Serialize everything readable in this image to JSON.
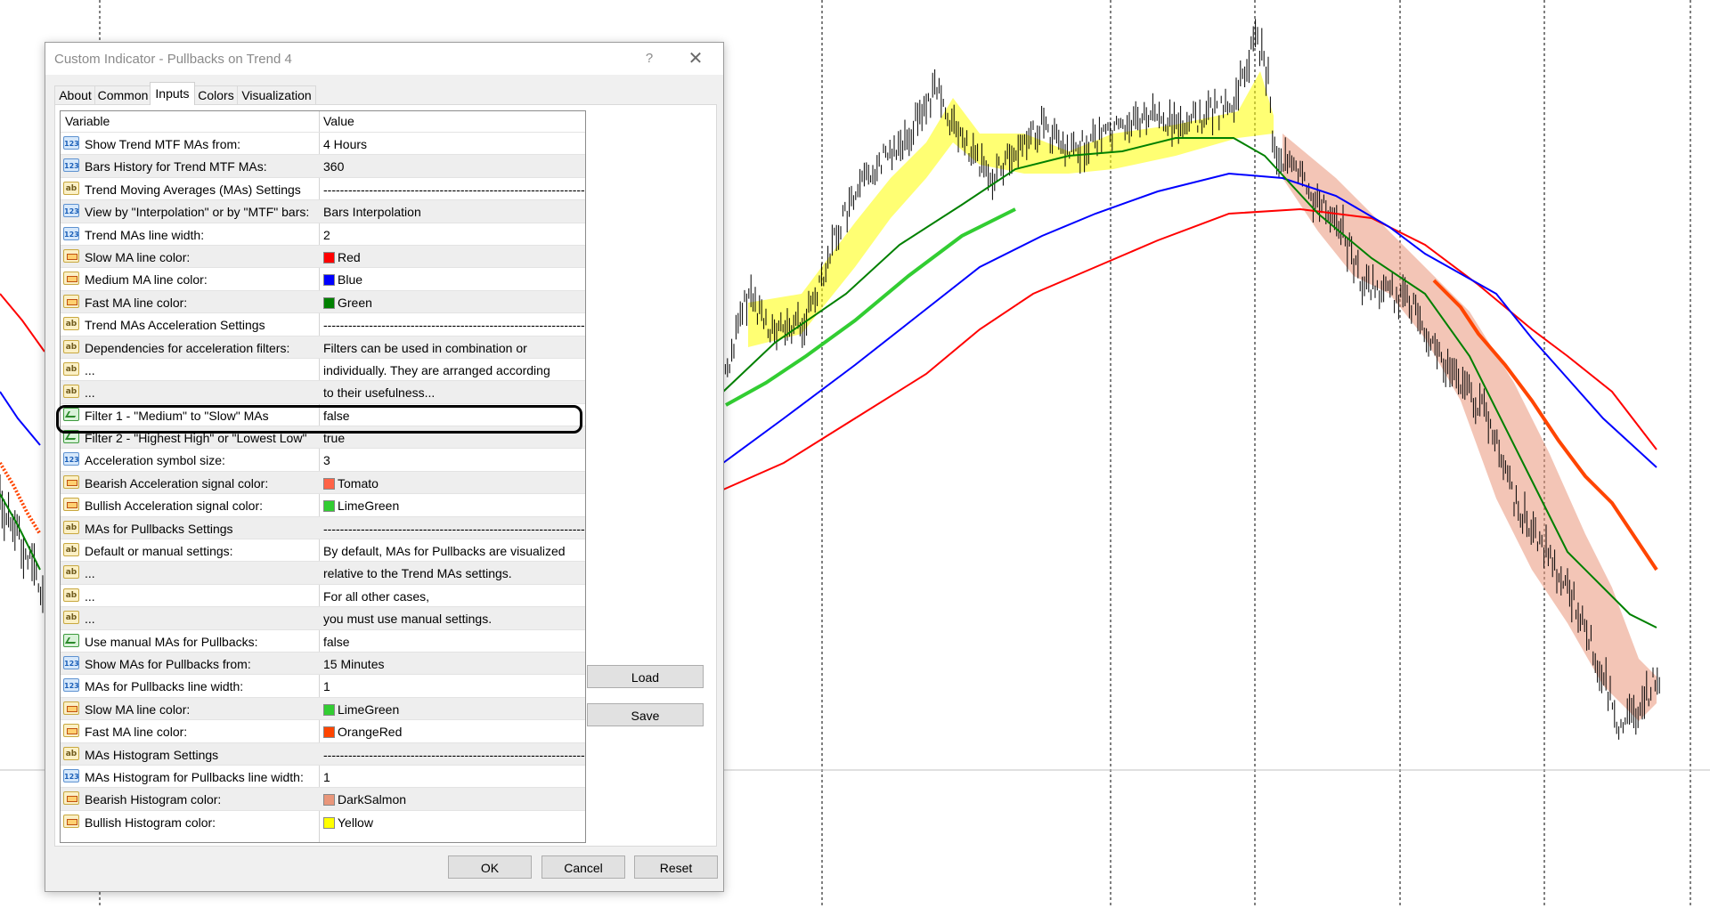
{
  "dialog": {
    "title": "Custom Indicator - Pullbacks on Trend 4",
    "help_label": "?",
    "close_label": "✕"
  },
  "tabs": [
    {
      "label": "About",
      "active": false
    },
    {
      "label": "Common",
      "active": false
    },
    {
      "label": "Inputs",
      "active": true
    },
    {
      "label": "Colors",
      "active": false
    },
    {
      "label": "Visualization",
      "active": false
    }
  ],
  "grid": {
    "header_variable": "Variable",
    "header_value": "Value",
    "rows": [
      {
        "type": "int",
        "name": "Show Trend MTF MAs from:",
        "value": "4 Hours"
      },
      {
        "type": "int",
        "name": "Bars History for Trend MTF MAs:",
        "value": "360"
      },
      {
        "type": "str",
        "name": "Trend Moving Averages (MAs) Settings",
        "value": "----------------------------------------------------------------------..."
      },
      {
        "type": "int",
        "name": "View by \"Interpolation\" or by \"MTF\" bars:",
        "value": "Bars Interpolation"
      },
      {
        "type": "int",
        "name": "Trend MAs line width:",
        "value": "2"
      },
      {
        "type": "clr",
        "name": "Slow MA line color:",
        "value": "Red",
        "swatch": "#ff0000"
      },
      {
        "type": "clr",
        "name": "Medium MA line color:",
        "value": "Blue",
        "swatch": "#0000ff"
      },
      {
        "type": "clr",
        "name": "Fast MA line color:",
        "value": "Green",
        "swatch": "#008000"
      },
      {
        "type": "str",
        "name": "Trend MAs Acceleration Settings",
        "value": "----------------------------------------------------------------------..."
      },
      {
        "type": "str",
        "name": "Dependencies for acceleration filters:",
        "value": "Filters can be used in combination or"
      },
      {
        "type": "str",
        "name": "...",
        "value": "individually. They are arranged according"
      },
      {
        "type": "str",
        "name": "...",
        "value": "to their usefulness..."
      },
      {
        "type": "bool",
        "name": "Filter 1 - \"Medium\" to \"Slow\" MAs",
        "value": "false"
      },
      {
        "type": "bool",
        "name": "Filter 2 - \"Highest High\" or \"Lowest Low\"",
        "value": "true"
      },
      {
        "type": "int",
        "name": "Acceleration symbol size:",
        "value": "3"
      },
      {
        "type": "clr",
        "name": "Bearish Acceleration signal color:",
        "value": "Tomato",
        "swatch": "#ff6347"
      },
      {
        "type": "clr",
        "name": "Bullish Acceleration signal color:",
        "value": "LimeGreen",
        "swatch": "#32cd32"
      },
      {
        "type": "str",
        "name": "MAs for Pullbacks Settings",
        "value": "----------------------------------------------------------------------..."
      },
      {
        "type": "str",
        "name": "Default or manual settings:",
        "value": "By default, MAs for Pullbacks are visualized"
      },
      {
        "type": "str",
        "name": "...",
        "value": "relative to the Trend MAs settings."
      },
      {
        "type": "str",
        "name": "...",
        "value": "For all other cases,"
      },
      {
        "type": "str",
        "name": "...",
        "value": "you must use manual settings."
      },
      {
        "type": "bool",
        "name": "Use manual MAs for Pullbacks:",
        "value": "false"
      },
      {
        "type": "int",
        "name": "Show MAs for Pullbacks from:",
        "value": "15 Minutes"
      },
      {
        "type": "int",
        "name": "MAs for Pullbacks line width:",
        "value": "1"
      },
      {
        "type": "clr",
        "name": "Slow MA line color:",
        "value": "LimeGreen",
        "swatch": "#32cd32"
      },
      {
        "type": "clr",
        "name": "Fast MA line color:",
        "value": "OrangeRed",
        "swatch": "#ff4500"
      },
      {
        "type": "str",
        "name": "MAs Histogram Settings",
        "value": "----------------------------------------------------------------------..."
      },
      {
        "type": "int",
        "name": "MAs Histogram for Pullbacks line width:",
        "value": "1"
      },
      {
        "type": "clr",
        "name": "Bearish Histogram color:",
        "value": "DarkSalmon",
        "swatch": "#e9967a"
      },
      {
        "type": "clr",
        "name": "Bullish Histogram color:",
        "value": "Yellow",
        "swatch": "#ffff00"
      }
    ]
  },
  "type_icons": {
    "int": "123",
    "str": "ab",
    "clr": "",
    "bool": ""
  },
  "buttons": {
    "load": "Load",
    "save": "Save",
    "ok": "OK",
    "cancel": "Cancel",
    "reset": "Reset"
  },
  "chart_colors": {
    "slow_ma": "#ff0000",
    "medium_ma": "#0000ff",
    "fast_ma": "#008000",
    "accel_bull": "#32cd32",
    "accel_bear": "#ff6347",
    "hist_bear": "#e9967a",
    "hist_bull": "#ffff00",
    "price": "#000000"
  }
}
